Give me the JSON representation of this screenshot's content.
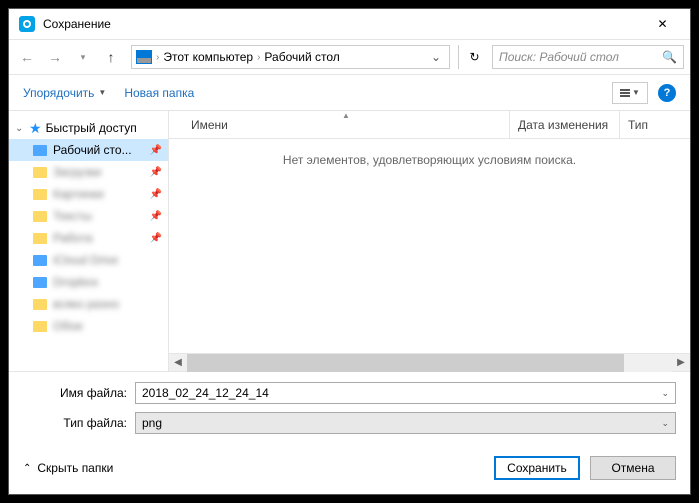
{
  "title": "Сохранение",
  "breadcrumb": {
    "root": "Этот компьютер",
    "current": "Рабочий стол"
  },
  "search": {
    "placeholder": "Поиск: Рабочий стол"
  },
  "toolbar": {
    "organize": "Упорядочить",
    "new_folder": "Новая папка"
  },
  "sidebar": {
    "quick_access": "Быстрый доступ",
    "selected": "Рабочий сто..."
  },
  "columns": {
    "name": "Имени",
    "date": "Дата изменения",
    "type": "Тип"
  },
  "empty_msg": "Нет элементов, удовлетворяющих условиям поиска.",
  "form": {
    "filename_label": "Имя файла:",
    "filename_value": "2018_02_24_12_24_14",
    "filetype_label": "Тип файла:",
    "filetype_value": "png"
  },
  "footer": {
    "hide_folders": "Скрыть папки",
    "save": "Сохранить",
    "cancel": "Отмена"
  }
}
